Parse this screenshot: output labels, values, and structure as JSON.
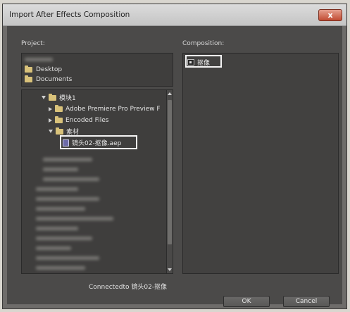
{
  "window": {
    "title": "Import After Effects Composition",
    "close_glyph": "x"
  },
  "project": {
    "label": "Project:",
    "places": [
      "Desktop",
      "Documents"
    ],
    "tree": [
      {
        "label": "模块1",
        "expanded": true
      },
      {
        "label": "Adobe Premiere Pro Preview F",
        "expanded": false
      },
      {
        "label": "Encoded Files",
        "expanded": false
      },
      {
        "label": "素材",
        "expanded": true
      },
      {
        "label": "镜头02-抠像.aep",
        "selected": true
      }
    ]
  },
  "composition": {
    "label": "Composition:",
    "items": [
      "抠像"
    ]
  },
  "status": {
    "text": "Connectedto 镜头02-抠像"
  },
  "buttons": {
    "ok": "OK",
    "cancel": "Cancel"
  },
  "colors": {
    "dialog_bg": "#4b4a49",
    "panel_bg": "#3f3e3d",
    "close_red": "#c14b32",
    "highlight": "#f4f4f4"
  }
}
